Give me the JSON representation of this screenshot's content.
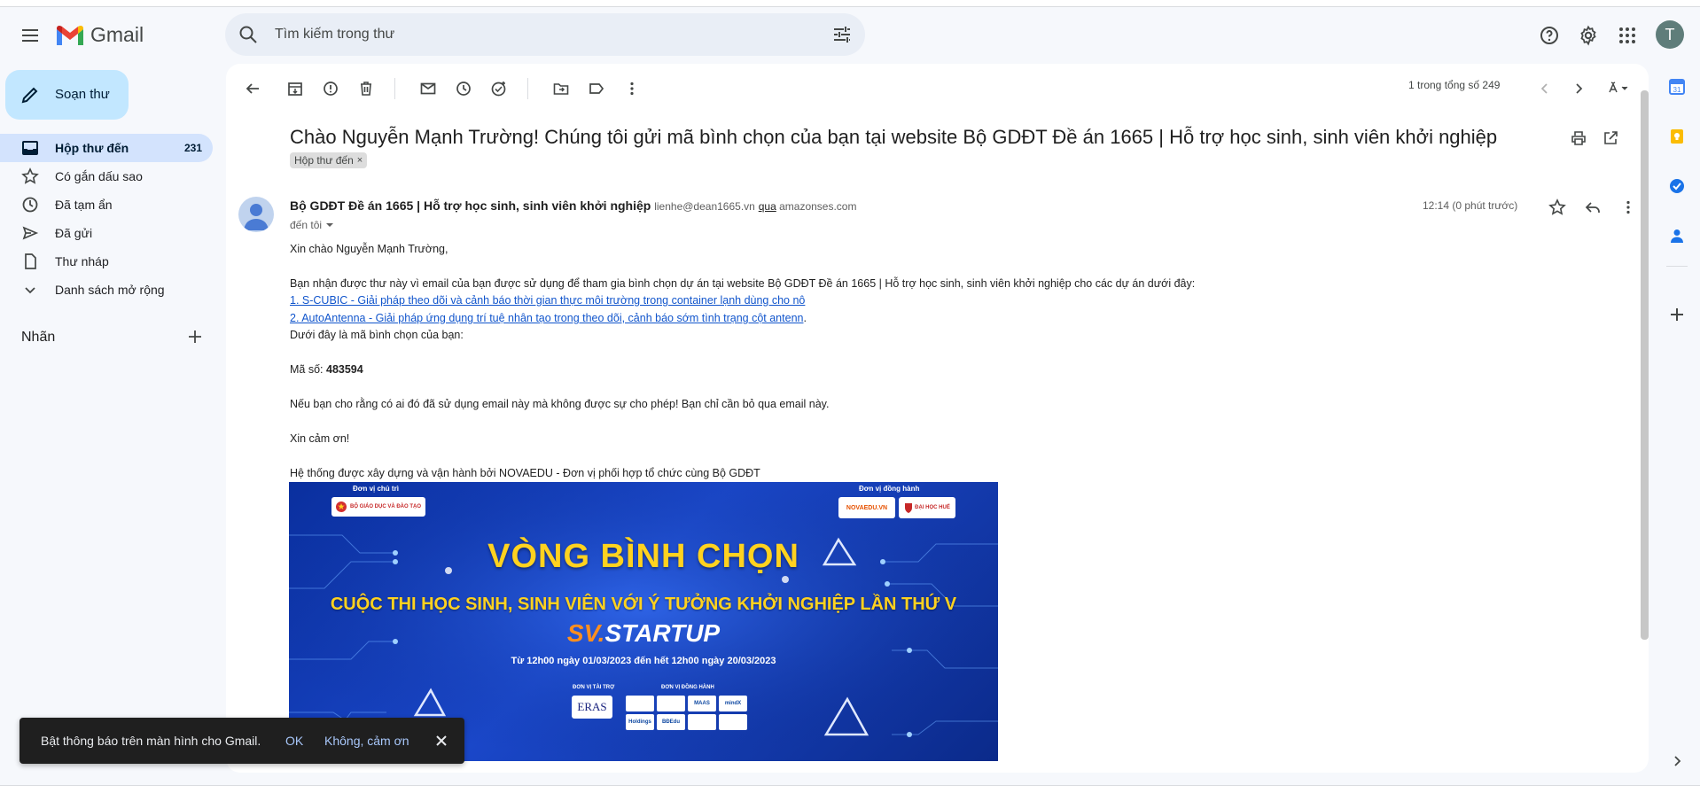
{
  "header": {
    "app_name": "Gmail",
    "search_placeholder": "Tìm kiếm trong thư",
    "avatar_letter": "T"
  },
  "compose": {
    "label": "Soạn thư"
  },
  "nav": {
    "items": [
      {
        "label": "Hộp thư đến",
        "count": "231",
        "icon": "inbox-icon"
      },
      {
        "label": "Có gắn dấu sao",
        "icon": "star-icon"
      },
      {
        "label": "Đã tạm ẩn",
        "icon": "clock-icon"
      },
      {
        "label": "Đã gửi",
        "icon": "send-icon"
      },
      {
        "label": "Thư nháp",
        "icon": "draft-icon"
      },
      {
        "label": "Danh sách mở rộng",
        "icon": "chevron-down-icon"
      }
    ],
    "labels_heading": "Nhãn"
  },
  "toolbar": {
    "page_count": "1 trong tổng số 249"
  },
  "email": {
    "subject": "Chào Nguyễn Mạnh Trường! Chúng tôi gửi mã bình chọn của bạn tại website Bộ GDĐT Đề án 1665 | Hỗ trợ học sinh, sinh viên khởi nghiệp",
    "label_chip": "Hộp thư đến",
    "label_chip_close": "×",
    "sender_name": "Bộ GDĐT Đề án 1665 | Hỗ trợ học sinh, sinh viên khởi nghiệp",
    "sender_email": "lienhe@dean1665.vn",
    "via_word": "qua",
    "via_domain": "amazonses.com",
    "to": "đến tôi",
    "time": "12:14 (0 phút trước)",
    "body": {
      "greeting": "Xin chào Nguyễn Mạnh Trường,",
      "intro": "Bạn nhận được thư này vì email của bạn được sử dụng để tham gia bình chọn dự án tại website Bộ GDĐT Đề án 1665 | Hỗ trợ học sinh, sinh viên khởi nghiệp cho các dự án dưới đây:",
      "link1": "1. S-CUBIC - Giải pháp theo dõi và cảnh báo thời gian thực môi trường trong container lạnh dùng cho nô",
      "link2": "2. AutoAntenna - Giải pháp ứng dụng trí tuệ nhân tạo trong theo dõi, cảnh báo sớm tình trạng cột antenn",
      "link2_suffix": ".",
      "code_intro": "Dưới đây là mã bình chọn của bạn:",
      "code_label": "Mã số:",
      "code_value": "483594",
      "warning": "Nếu bạn cho rằng có ai đó đã sử dụng email này mà không được sự cho phép! Bạn chỉ cần bỏ qua email này.",
      "thanks": "Xin cảm ơn!",
      "footer": "Hệ thống được xây dựng và vận hành bởi NOVAEDU - Đơn vị phối hợp tổ chức cùng Bộ GDĐT"
    },
    "banner": {
      "host_label": "Đơn vị chủ trì",
      "host_org": "BỘ GIÁO DỤC VÀ ĐÀO TẠO",
      "partner_label": "Đơn vị đồng hành",
      "partner1": "NOVAEDU.VN",
      "partner2": "ĐẠI HỌC HUẾ",
      "title": "VÒNG BÌNH CHỌN",
      "subtitle": "CUỘC THI HỌC SINH, SINH VIÊN VỚI Ý TƯỞNG KHỞI NGHIỆP LẦN THỨ V",
      "brand_sv": "SV.",
      "brand_startup": "STARTUP",
      "date_range": "Từ 12h00 ngày 01/03/2023 đến hết 12h00 ngày 20/03/2023",
      "sponsor_label": "ĐƠN VỊ TÀI TRỢ",
      "sponsor": "ERAS",
      "companion_label": "ĐƠN VỊ ĐỒNG HÀNH",
      "companion_logos": [
        "",
        "",
        "MAAS",
        "mindX",
        "Holdings",
        "BĐEdu",
        "",
        ""
      ]
    }
  },
  "snackbar": {
    "message": "Bật thông báo trên màn hình cho Gmail.",
    "ok": "OK",
    "no_thanks": "Không, cảm ơn"
  },
  "colors": {
    "accent": "#0b57d0",
    "compose_bg": "#c2e7ff",
    "active_nav_bg": "#d3e3fd",
    "link": "#1155cc",
    "banner_blue": "#1a47c9",
    "banner_yellow": "#ffd21f"
  }
}
